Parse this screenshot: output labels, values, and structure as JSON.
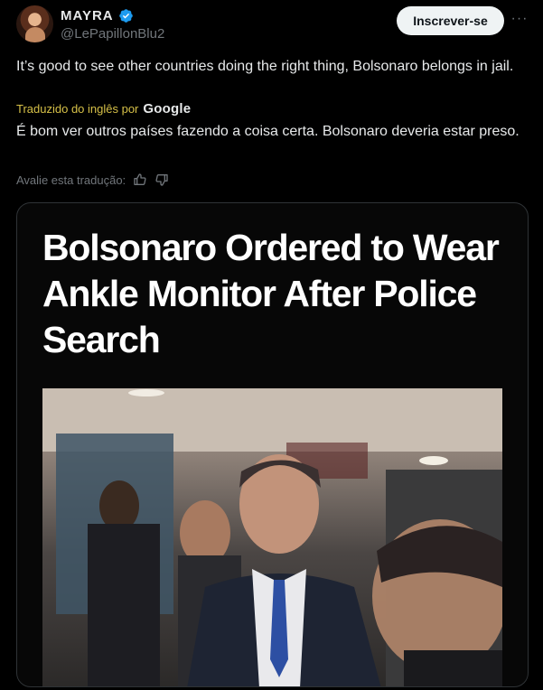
{
  "author": {
    "display_name": "MAYRA",
    "handle": "@LePapillonBlu2",
    "verified_icon": "verified-badge-icon"
  },
  "actions": {
    "subscribe_label": "Inscrever-se",
    "more_label": "···"
  },
  "tweet": {
    "text": "It’s good to see other countries doing the right thing, Bolsonaro belongs in jail.",
    "translated_label": "Traduzido do inglês por",
    "translator": "Google",
    "translation": "É bom ver outros países fazendo a coisa certa. Bolsonaro deveria estar preso.",
    "rate_label": "Avalie esta tradução:"
  },
  "media": {
    "headline": "Bolsonaro Ordered to Wear Ankle Monitor After Police Search"
  },
  "colors": {
    "background": "#000000",
    "text": "#e7e9ea",
    "muted": "#71767b",
    "verified": "#1d9bf0",
    "translated": "#d6c048"
  }
}
